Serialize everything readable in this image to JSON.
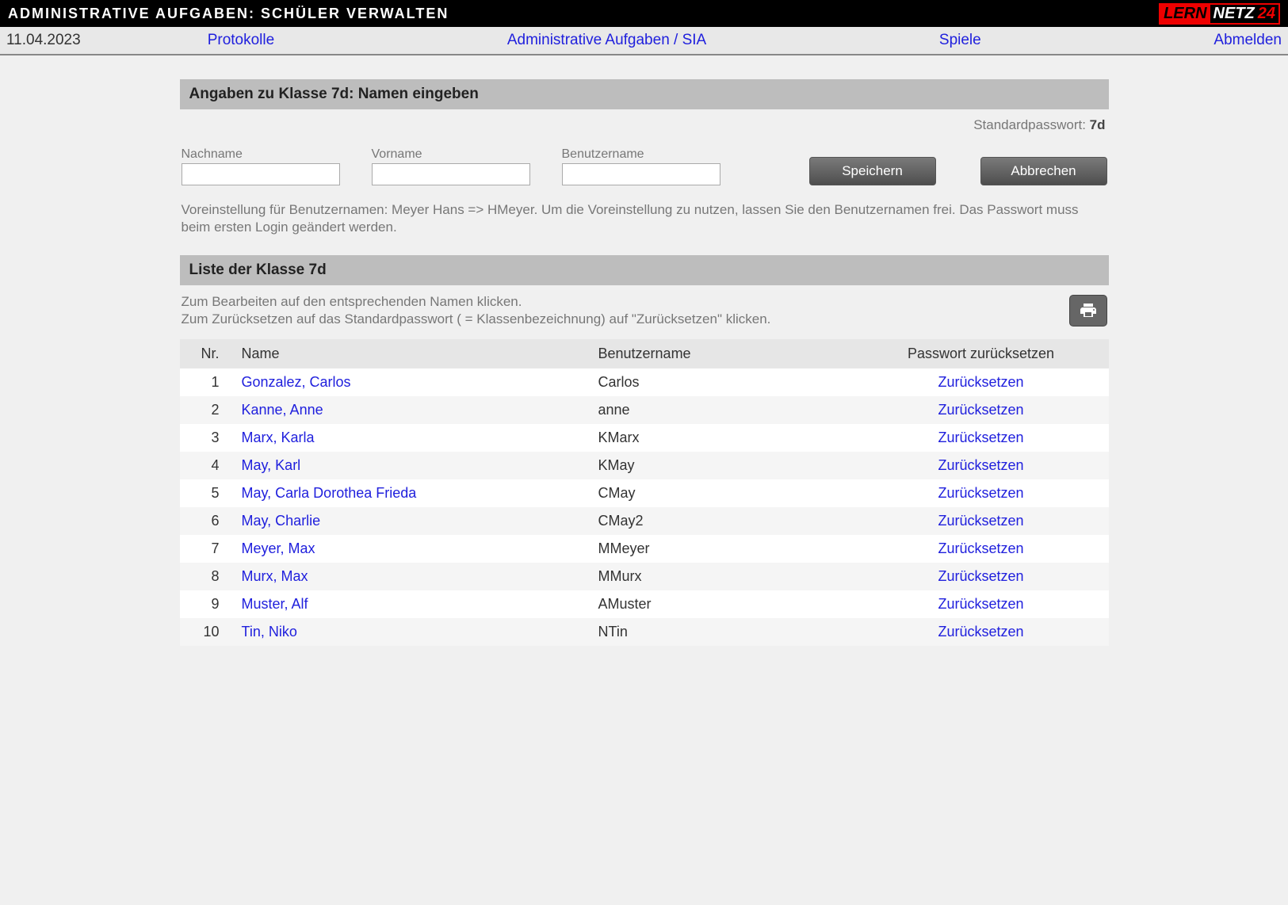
{
  "header": {
    "title": "ADMINISTRATIVE AUFGABEN: SCHÜLER VERWALTEN",
    "logo_lern": "LERN",
    "logo_netz": "NETZ",
    "logo_24": "24"
  },
  "nav": {
    "date": "11.04.2023",
    "protokolle": "Protokolle",
    "admin": "Administrative Aufgaben / SIA",
    "spiele": "Spiele",
    "abmelden": "Abmelden"
  },
  "form_section": {
    "heading": "Angaben zu Klasse 7d: Namen eingeben",
    "pw_label": "Standardpasswort: ",
    "pw_value": "7d",
    "lastname_label": "Nachname",
    "firstname_label": "Vorname",
    "username_label": "Benutzername",
    "save_label": "Speichern",
    "cancel_label": "Abbrechen",
    "hint": "Voreinstellung für Benutzernamen: Meyer Hans => HMeyer. Um die Voreinstellung zu nutzen, lassen Sie den Benutzernamen frei. Das Passwort muss beim ersten Login geändert werden."
  },
  "list_section": {
    "heading": "Liste der Klasse 7d",
    "intro_line1": "Zum Bearbeiten auf den entsprechenden Namen klicken.",
    "intro_line2": "Zum Zurücksetzen auf das Standardpasswort ( = Klassenbezeichnung) auf \"Zurücksetzen\" klicken.",
    "col_nr": "Nr.",
    "col_name": "Name",
    "col_user": "Benutzername",
    "col_reset": "Passwort zurücksetzen",
    "reset_label": "Zurücksetzen",
    "students": [
      {
        "nr": "1",
        "name": "Gonzalez, Carlos",
        "user": "Carlos"
      },
      {
        "nr": "2",
        "name": "Kanne, Anne",
        "user": "anne"
      },
      {
        "nr": "3",
        "name": "Marx, Karla",
        "user": "KMarx"
      },
      {
        "nr": "4",
        "name": "May, Karl",
        "user": "KMay"
      },
      {
        "nr": "5",
        "name": "May, Carla Dorothea Frieda",
        "user": "CMay"
      },
      {
        "nr": "6",
        "name": "May, Charlie",
        "user": "CMay2"
      },
      {
        "nr": "7",
        "name": "Meyer, Max",
        "user": "MMeyer"
      },
      {
        "nr": "8",
        "name": "Murx, Max",
        "user": "MMurx"
      },
      {
        "nr": "9",
        "name": "Muster, Alf",
        "user": "AMuster"
      },
      {
        "nr": "10",
        "name": "Tin, Niko",
        "user": "NTin"
      }
    ]
  }
}
